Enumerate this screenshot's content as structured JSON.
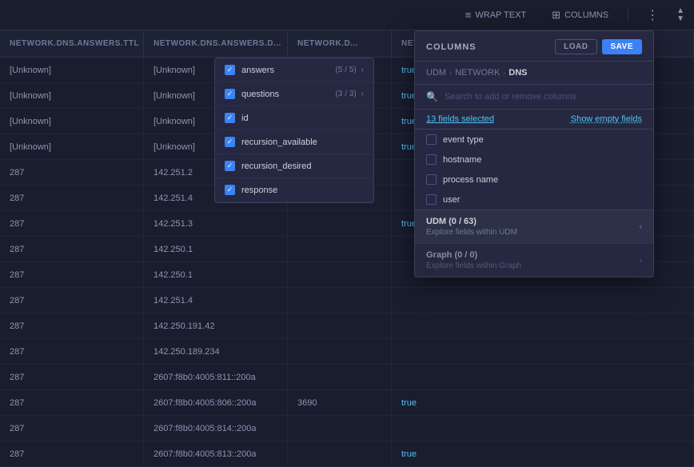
{
  "toolbar": {
    "wrap_text_label": "WRAP TEXT",
    "columns_label": "COLUMNS",
    "wrap_icon": "≡",
    "columns_icon": "⊞"
  },
  "table": {
    "headers": [
      "NETWORK.DNS.ANSWERS.TTL",
      "NETWORK.DNS.ANSWERS.D...",
      "NETWORK.D...",
      "NETWORK.DNS.RECUR..."
    ],
    "rows": [
      {
        "col1": "[Unknown]",
        "col2": "[Unknown]",
        "col3": "",
        "col4": "true"
      },
      {
        "col1": "[Unknown]",
        "col2": "[Unknown]",
        "col3": "",
        "col4": "true"
      },
      {
        "col1": "[Unknown]",
        "col2": "[Unknown]",
        "col3": "",
        "col4": "true"
      },
      {
        "col1": "[Unknown]",
        "col2": "[Unknown]",
        "col3": "",
        "col4": "true"
      },
      {
        "col1": "287",
        "col2": "142.251.2",
        "col3": "",
        "col4": ""
      },
      {
        "col1": "287",
        "col2": "142.251.4",
        "col3": "",
        "col4": ""
      },
      {
        "col1": "287",
        "col2": "142.251.3",
        "col3": "",
        "col4": "true"
      },
      {
        "col1": "287",
        "col2": "142.250.1",
        "col3": "",
        "col4": ""
      },
      {
        "col1": "287",
        "col2": "142.250.1",
        "col3": "",
        "col4": ""
      },
      {
        "col1": "287",
        "col2": "142.251.4",
        "col3": "",
        "col4": ""
      },
      {
        "col1": "287",
        "col2": "142.250.191.42",
        "col3": "",
        "col4": ""
      },
      {
        "col1": "287",
        "col2": "142.250.189.234",
        "col3": "",
        "col4": ""
      },
      {
        "col1": "287",
        "col2": "2607:f8b0:4005:811::200a",
        "col3": "",
        "col4": ""
      },
      {
        "col1": "287",
        "col2": "2607:f8b0:4005:806::200a",
        "col3": "3690",
        "col4": "true"
      },
      {
        "col1": "287",
        "col2": "2607:f8b0:4005:814::200a",
        "col3": "",
        "col4": ""
      },
      {
        "col1": "287",
        "col2": "2607:f8b0:4005:813::200a",
        "col3": "",
        "col4": "true"
      }
    ]
  },
  "columns_panel": {
    "title": "COLUMNS",
    "load_label": "LOAD",
    "save_label": "SAVE",
    "search_placeholder": "Search to add or remove columns",
    "fields_selected": "13 fields selected",
    "show_empty_fields": "Show empty fields",
    "breadcrumb": {
      "root": "UDM",
      "level1": "NETWORK",
      "level2": "DNS"
    },
    "fields": [
      {
        "name": "event type",
        "checked": false
      },
      {
        "name": "hostname",
        "checked": false
      },
      {
        "name": "process name",
        "checked": false
      },
      {
        "name": "user",
        "checked": false
      }
    ],
    "groups": [
      {
        "title": "UDM (0 / 63)",
        "sub": "Explore fields within UDM",
        "active": true,
        "chevron": "‹"
      },
      {
        "title": "Graph (0 / 0)",
        "sub": "Explore fields within Graph",
        "active": false,
        "chevron": "›"
      }
    ]
  },
  "left_panel": {
    "items": [
      {
        "label": "answers",
        "count": "(5 / 5)",
        "checked": true
      },
      {
        "label": "questions",
        "count": "(3 / 3)",
        "checked": true
      },
      {
        "label": "id",
        "checked": true
      },
      {
        "label": "recursion_available",
        "checked": true
      },
      {
        "label": "recursion_desired",
        "checked": true
      },
      {
        "label": "response",
        "checked": true
      }
    ]
  }
}
